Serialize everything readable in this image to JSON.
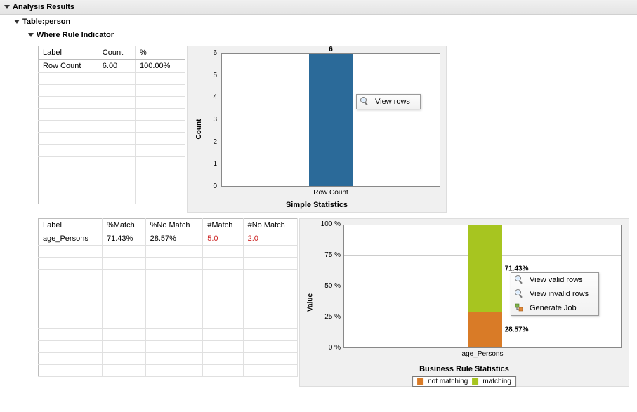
{
  "header": {
    "title": "Analysis Results"
  },
  "tree": {
    "table_label": "Table:person",
    "indicator_label": "Where Rule Indicator"
  },
  "table1": {
    "headers": {
      "label": "Label",
      "count": "Count",
      "pct": "%"
    },
    "rows": [
      {
        "label": "Row Count",
        "count": "6.00",
        "pct": "100.00%"
      }
    ]
  },
  "chart1_menu": {
    "view_rows": "View rows"
  },
  "table2": {
    "headers": {
      "label": "Label",
      "pmatch": "%Match",
      "pnomatch": "%No Match",
      "nmatch": "#Match",
      "nnomatch": "#No Match"
    },
    "rows": [
      {
        "label": "age_Persons",
        "pmatch": "71.43%",
        "pnomatch": "28.57%",
        "nmatch": "5.0",
        "nnomatch": "2.0"
      }
    ]
  },
  "chart2_menu": {
    "view_valid": "View valid rows",
    "view_invalid": "View invalid rows",
    "generate_job": "Generate Job"
  },
  "chart_data": [
    {
      "type": "bar",
      "title": "Simple Statistics",
      "categories": [
        "Row Count"
      ],
      "values": [
        6
      ],
      "ylabel": "Count",
      "ylim": [
        0,
        6
      ],
      "yticks": [
        "0",
        "1",
        "2",
        "3",
        "4",
        "5",
        "6"
      ],
      "bar_label": "6"
    },
    {
      "type": "bar_stacked",
      "title": "Business Rule Statistics",
      "categories": [
        "age_Persons"
      ],
      "series": [
        {
          "name": "not matching",
          "values": [
            28.57
          ]
        },
        {
          "name": "matching",
          "values": [
            71.43
          ]
        }
      ],
      "labels": {
        "match": "71.43%",
        "notmatch": "28.57%"
      },
      "ylabel": "Value",
      "ylim": [
        0,
        100
      ],
      "yticks": [
        "0 %",
        "25 %",
        "50 %",
        "75 %",
        "100 %"
      ],
      "legend": {
        "notmatch": "not matching",
        "match": "matching"
      }
    }
  ]
}
